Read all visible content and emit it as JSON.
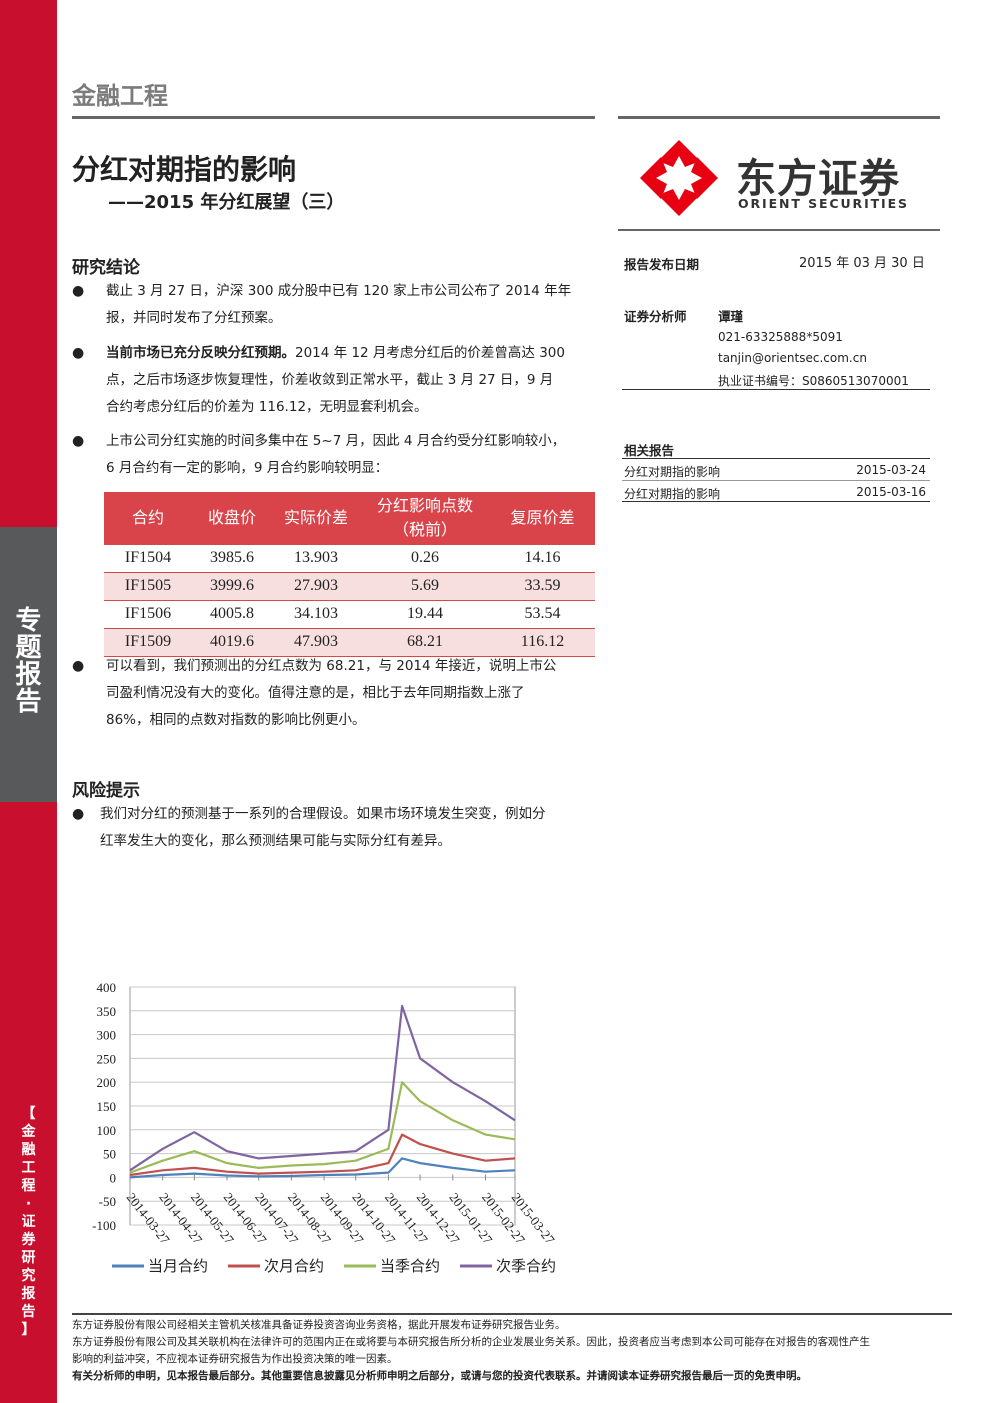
{
  "sidebar": {
    "report_type": "专题报告",
    "series": "【金融工程·证券研究报告】"
  },
  "header": {
    "section": "金融工程",
    "title": "分红对期指的影响",
    "subtitle": "——2015 年分红展望（三）"
  },
  "logo": {
    "cn": "东方证券",
    "en": "ORIENT SECURITIES",
    "brand_color": "#e60012"
  },
  "conclusions": {
    "heading": "研究结论",
    "bullet1": [
      "截止 3 月 27 日，沪深 300 成分股中已有 120 家上市公司公布了 2014 年年",
      "报，并同时发布了分红预案。"
    ],
    "bullet2_bold": "当前市场已充分反映分红预期。",
    "bullet2": [
      "2014 年 12 月考虑分红后的价差曾高达 300",
      "点，之后市场逐步恢复理性，价差收敛到正常水平，截止 3 月 27 日，9 月",
      "合约考虑分红后的价差为 116.12，无明显套利机会。"
    ],
    "bullet3": [
      "上市公司分红实施的时间多集中在 5~7 月，因此 4 月合约受分红影响较小，",
      "6 月合约有一定的影响，9 月合约影响较明显："
    ],
    "bullet4": [
      "可以看到，我们预测出的分红点数为 68.21，与 2014 年接近，说明上市公",
      "司盈利情况没有大的变化。值得注意的是，相比于去年同期指数上涨了",
      "86%，相同的点数对指数的影响比例更小。"
    ]
  },
  "table": {
    "headers": [
      "合约",
      "收盘价",
      "实际价差",
      "分红影响点数",
      "（税前）",
      "复原价差"
    ],
    "rows": [
      [
        "IF1504",
        "3985.6",
        "13.903",
        "0.26",
        "14.16"
      ],
      [
        "IF1505",
        "3999.6",
        "27.903",
        "5.69",
        "33.59"
      ],
      [
        "IF1506",
        "4005.8",
        "34.103",
        "19.44",
        "53.54"
      ],
      [
        "IF1509",
        "4019.6",
        "47.903",
        "68.21",
        "116.12"
      ]
    ]
  },
  "risk": {
    "heading": "风险提示",
    "bullet": [
      "我们对分红的预测基于一系列的合理假设。如果市场环境发生突变，例如分",
      "红率发生大的变化，那么预测结果可能与实际分红有差异。"
    ]
  },
  "meta": {
    "date_label": "报告发布日期",
    "date": "2015 年 03 月 30 日",
    "analyst_label": "证券分析师",
    "analyst_name": "谭瑾",
    "phone": "021-63325888*5091",
    "email": "tanjin@orientsec.com.cn",
    "license": "执业证书编号：S0860513070001"
  },
  "related": {
    "heading": "相关报告",
    "items": [
      {
        "title": "分红对期指的影响",
        "date": "2015-03-24"
      },
      {
        "title": "分红对期指的影响",
        "date": "2015-03-16"
      }
    ]
  },
  "chart_data": {
    "type": "line",
    "ylim": [
      -100,
      400
    ],
    "yticks": [
      "400",
      "350",
      "300",
      "250",
      "200",
      "150",
      "100",
      "50",
      "0",
      "-50",
      "-100"
    ],
    "xticks": [
      "2014-03-27",
      "2014-04-27",
      "2014-05-27",
      "2014-06-27",
      "2014-07-27",
      "2014-08-27",
      "2014-09-27",
      "2014-10-27",
      "2014-11-27",
      "2014-12-27",
      "2015-01-27",
      "2015-02-27",
      "2015-03-27"
    ],
    "x_at_series": [
      "2014-03-27",
      "2014-04-27",
      "2014-05-27",
      "2014-06-27",
      "2014-07-27",
      "2014-08-27",
      "2014-09-27",
      "2014-10-27",
      "2014-11-27",
      "2014-12-10",
      "2014-12-27",
      "2015-01-27",
      "2015-02-27",
      "2015-03-27"
    ],
    "series": [
      {
        "name": "当月合约",
        "color": "#4f81bd",
        "values": [
          0,
          5,
          8,
          4,
          2,
          3,
          5,
          6,
          10,
          40,
          30,
          20,
          12,
          15
        ]
      },
      {
        "name": "次月合约",
        "color": "#c0504d",
        "values": [
          5,
          15,
          20,
          12,
          8,
          10,
          12,
          15,
          30,
          90,
          70,
          50,
          35,
          40
        ]
      },
      {
        "name": "当季合约",
        "color": "#9bbb59",
        "values": [
          10,
          35,
          55,
          30,
          20,
          25,
          28,
          35,
          60,
          200,
          160,
          120,
          90,
          80
        ]
      },
      {
        "name": "次季合约",
        "color": "#8064a2",
        "values": [
          15,
          60,
          95,
          55,
          40,
          45,
          50,
          55,
          100,
          360,
          250,
          200,
          160,
          120
        ]
      }
    ]
  },
  "footer": {
    "line1": "东方证券股份有限公司经相关主管机关核准具备证券投资咨询业务资格，据此开展发布证券研究报告业务。",
    "line2": "东方证券股份有限公司及其关联机构在法律许可的范围内正在或将要与本研究报告所分析的企业发展业务关系。因此，投资者应当考虑到本公司可能存在对报告的客观性产生",
    "line3": "影响的利益冲突，不应视本证券研究报告为作出投资决策的唯一因素。",
    "line4": "有关分析师的申明，见本报告最后部分。其他重要信息披露见分析师申明之后部分，或请与您的投资代表联系。并请阅读本证券研究报告最后一页的免责申明。"
  }
}
